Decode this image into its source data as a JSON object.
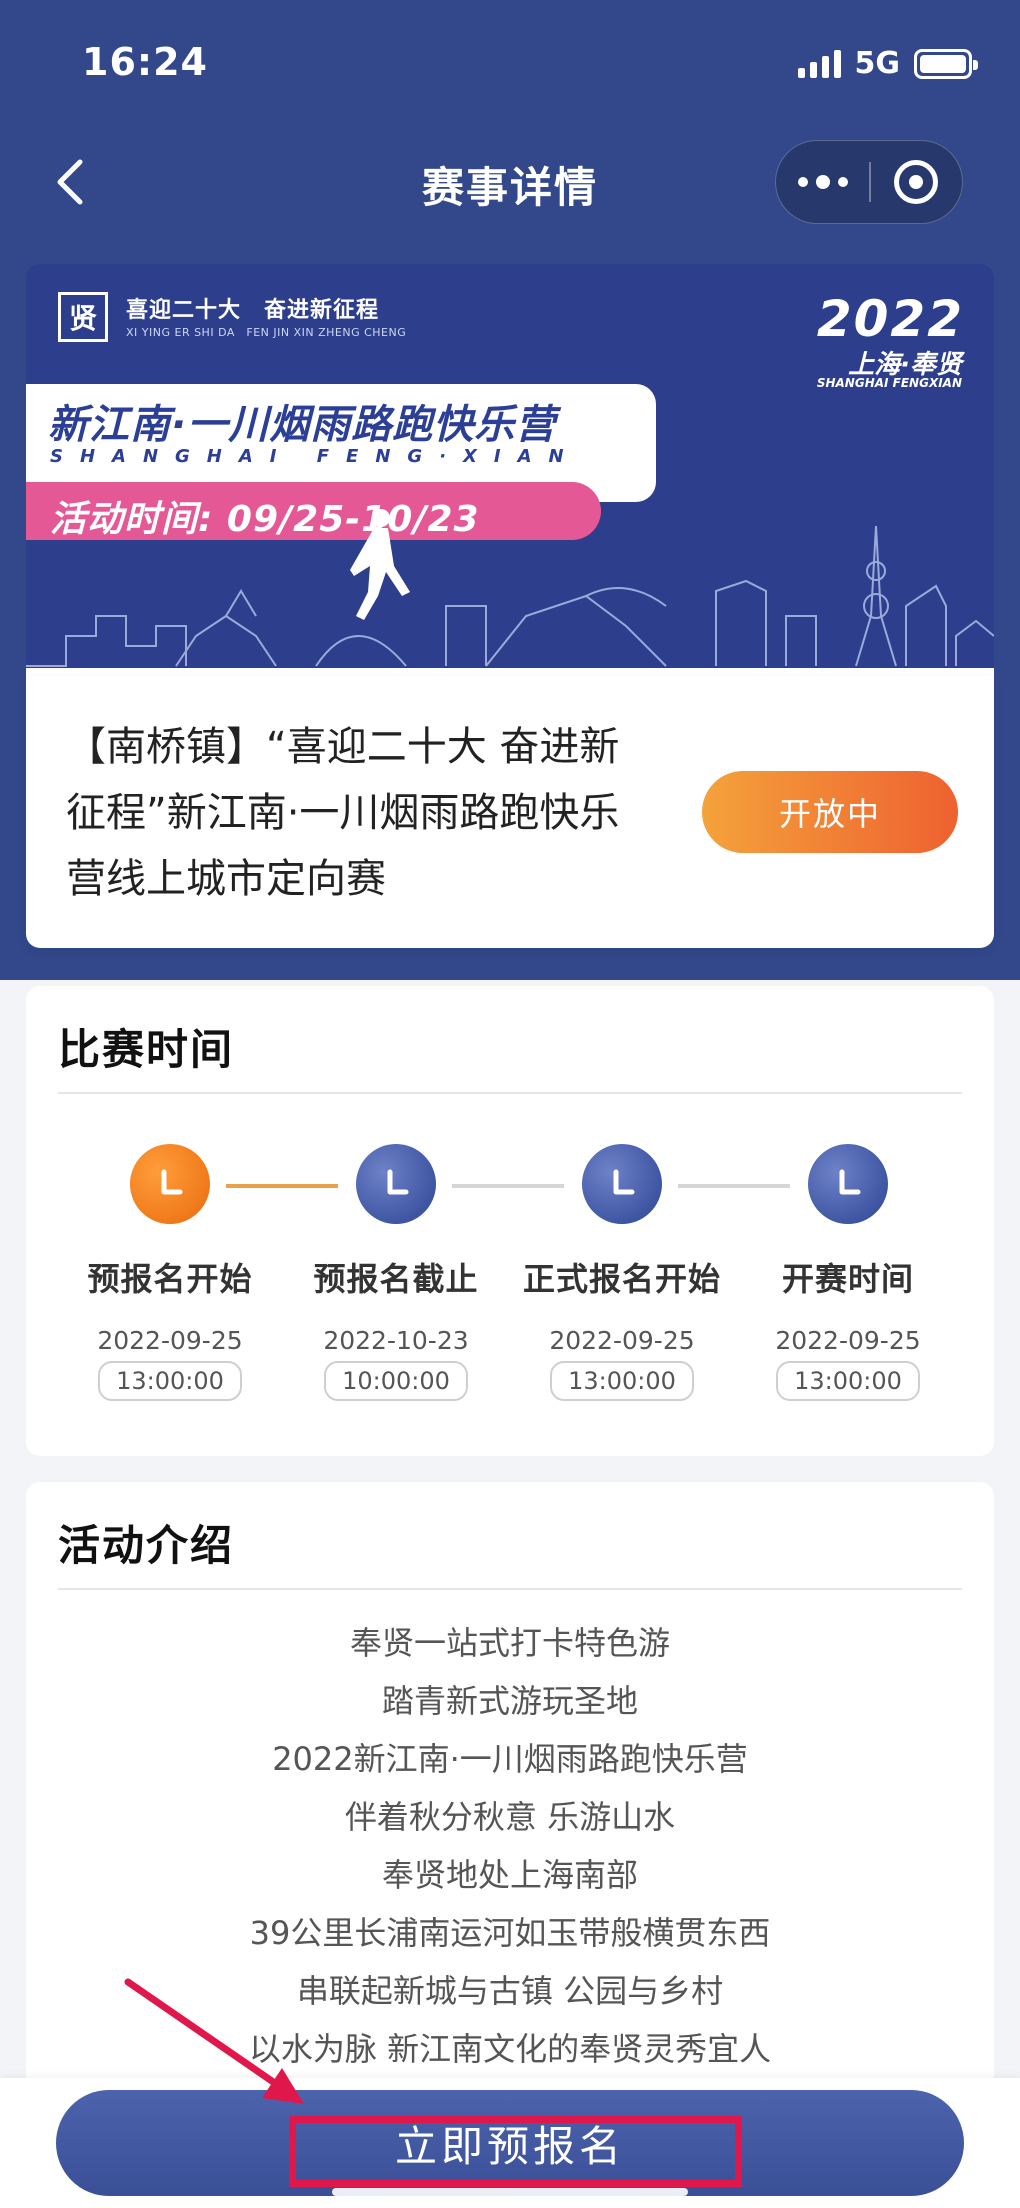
{
  "status_bar": {
    "time": "16:24",
    "network": "5G"
  },
  "nav": {
    "title": "赛事详情"
  },
  "banner": {
    "slogan": "喜迎二十大　奋进新征程",
    "slogan_pinyin": "XI YING ER SHI DA　FEN JIN XIN ZHENG CHENG",
    "year": "2022",
    "city": "上海·奉贤",
    "city_pinyin": "SHANGHAI FENGXIAN",
    "title": "新江南·一川烟雨路跑快乐营",
    "title_pinyin": "SHANGHAI FENG·XIAN",
    "date": "活动时间: 09/25-10/23"
  },
  "event": {
    "title": "【南桥镇】“喜迎二十大 奋进新征程”新江南·一川烟雨路跑快乐营线上城市定向赛",
    "status": "开放中"
  },
  "schedule": {
    "title": "比赛时间",
    "steps": [
      {
        "label": "预报名开始",
        "date": "2022-09-25",
        "time": "13:00:00",
        "state": "active"
      },
      {
        "label": "预报名截止",
        "date": "2022-10-23",
        "time": "10:00:00",
        "state": "inactive"
      },
      {
        "label": "正式报名开始",
        "date": "2022-09-25",
        "time": "13:00:00",
        "state": "inactive"
      },
      {
        "label": "开赛时间",
        "date": "2022-09-25",
        "time": "13:00:00",
        "state": "inactive"
      }
    ],
    "colors": {
      "active": "#f07a1a",
      "inactive": "#3f56a3",
      "line_active": "#e8a04a",
      "line_inactive": "#d6d6d6"
    }
  },
  "intro": {
    "title": "活动介绍",
    "lines": [
      "奉贤一站式打卡特色游",
      "踏青新式游玩圣地",
      "2022新江南·一川烟雨路跑快乐营",
      "伴着秋分秋意 乐游山水",
      "奉贤地处上海南部",
      "39公里长浦南运河如玉带般横贯东西",
      "串联起新城与古镇 公园与乡村",
      "以水为脉 新江南文化的奉贤灵秀宜人"
    ]
  },
  "cta": {
    "label": "立即预报名"
  },
  "icons": {
    "back": "chevron-left-icon",
    "more": "more-dots-icon",
    "close": "target-circle-icon",
    "clock": "clock-icon"
  }
}
